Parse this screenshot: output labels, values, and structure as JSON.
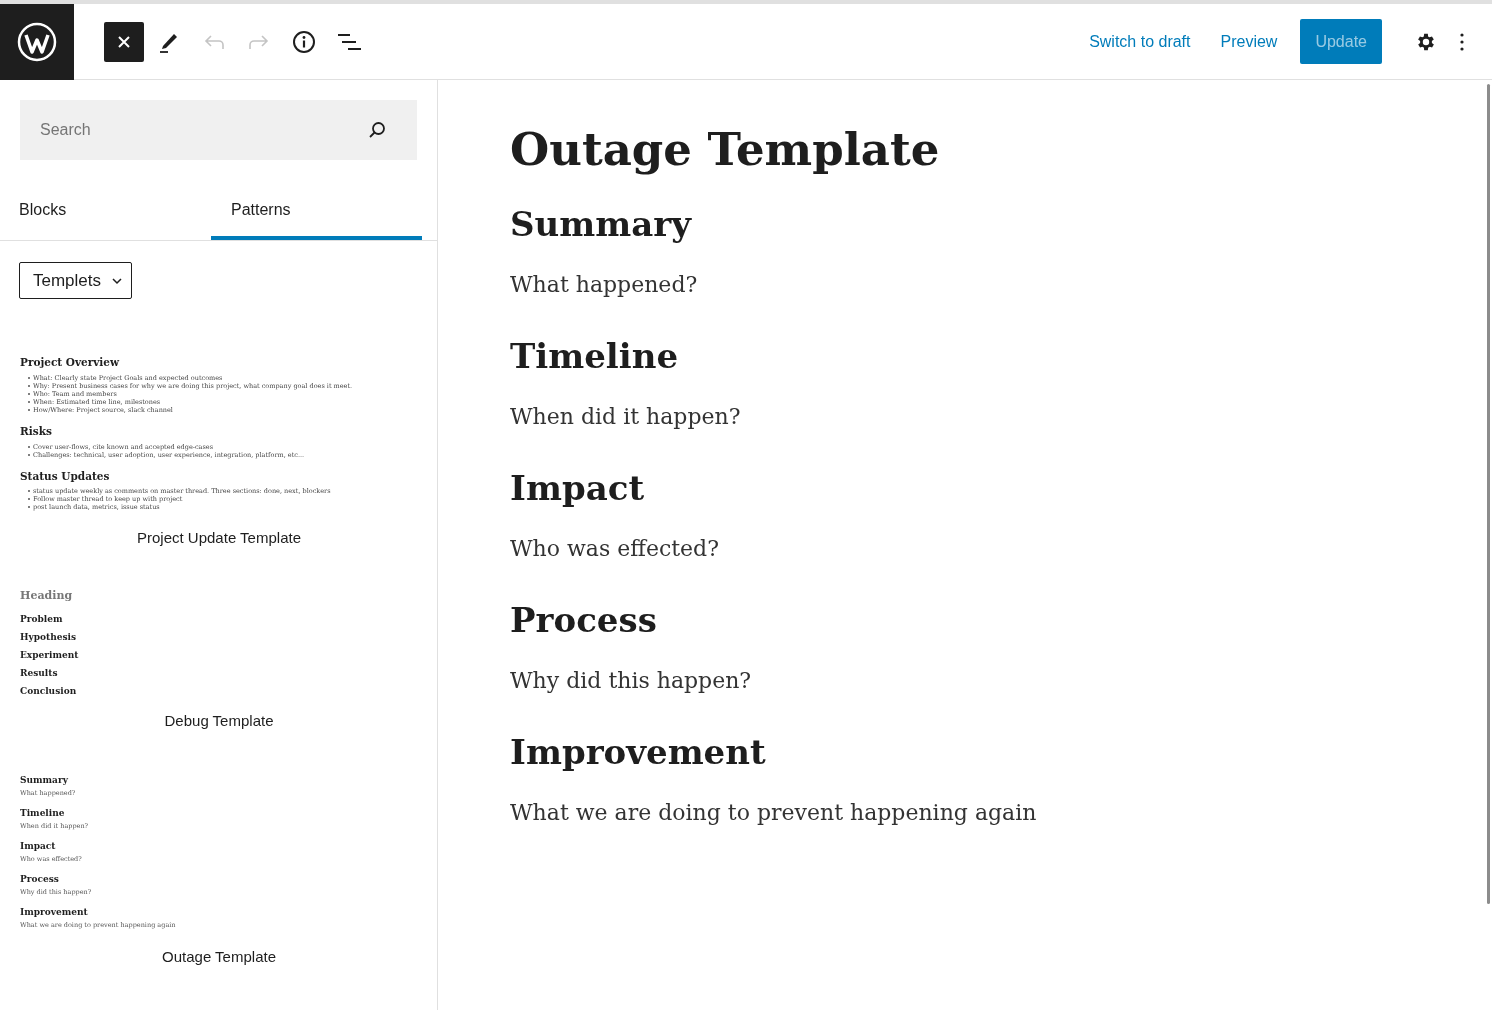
{
  "toolbar": {
    "tools": [
      {
        "kind": "close",
        "selected": true,
        "disabled": false
      },
      {
        "kind": "pencil",
        "selected": false,
        "disabled": false
      },
      {
        "kind": "undo",
        "selected": false,
        "disabled": true
      },
      {
        "kind": "redo",
        "selected": false,
        "disabled": true
      },
      {
        "kind": "info",
        "selected": false,
        "disabled": false
      },
      {
        "kind": "outline",
        "selected": false,
        "disabled": false
      }
    ],
    "actions": [
      {
        "kind": "link",
        "label": "Switch to draft"
      },
      {
        "kind": "link",
        "label": "Preview"
      },
      {
        "kind": "primary",
        "label": "Update",
        "disabled": true
      }
    ]
  },
  "inserter": {
    "search": {
      "placeholder": "Search"
    },
    "tabs": [
      {
        "label": "Blocks",
        "selected": false
      },
      {
        "label": "Patterns",
        "selected": true
      }
    ],
    "category": "Templets",
    "patterns": [
      {
        "label": "Project Update Template",
        "preview": [
          {
            "kind": "heading",
            "text": "Project Overview"
          },
          {
            "kind": "bullets",
            "items": [
              "What: Clearly state Project Goals and expected outcomes",
              "Why: Present business cases for why we are doing this project, what company goal does it meet.",
              "Who: Team and members",
              "When: Estimated time line, milestones",
              "How/Where: Project source, slack channel"
            ]
          },
          {
            "kind": "heading",
            "text": "Risks"
          },
          {
            "kind": "bullets",
            "items": [
              "Cover user-flows, cite known and accepted edge-cases",
              "Challenges: technical, user adoption, user experience, integration, platform, etc..."
            ]
          },
          {
            "kind": "heading",
            "text": "Status Updates"
          },
          {
            "kind": "bullets",
            "items": [
              "status update weekly as comments on master thread. Three sections: done, next, blockers",
              "Follow master thread to keep up with project",
              "post launch data, metrics, issue status"
            ]
          }
        ]
      },
      {
        "label": "Debug Template",
        "preview": [
          {
            "kind": "muted_heading",
            "text": "Heading"
          },
          {
            "kind": "subheading",
            "text": "Problem"
          },
          {
            "kind": "subheading",
            "text": "Hypothesis"
          },
          {
            "kind": "subheading",
            "text": "Experiment"
          },
          {
            "kind": "subheading",
            "text": "Results"
          },
          {
            "kind": "subheading",
            "text": "Conclusion"
          }
        ]
      },
      {
        "label": "Outage Template",
        "preview": [
          {
            "kind": "subheading",
            "text": "Summary"
          },
          {
            "kind": "paragraph",
            "text": "What happened?"
          },
          {
            "kind": "subheading",
            "text": "Timeline"
          },
          {
            "kind": "paragraph",
            "text": "When did it happen?"
          },
          {
            "kind": "subheading",
            "text": "Impact"
          },
          {
            "kind": "paragraph",
            "text": "Who was effected?"
          },
          {
            "kind": "subheading",
            "text": "Process"
          },
          {
            "kind": "paragraph",
            "text": "Why did this happen?"
          },
          {
            "kind": "subheading",
            "text": "Improvement"
          },
          {
            "kind": "paragraph",
            "text": "What we are doing to prevent happening again"
          }
        ]
      }
    ]
  },
  "editor": {
    "title": "Outage Template",
    "sections": [
      {
        "heading": "Summary",
        "text": "What happened?"
      },
      {
        "heading": "Timeline",
        "text": "When did it happen?"
      },
      {
        "heading": "Impact",
        "text": "Who was effected?"
      },
      {
        "heading": "Process",
        "text": "Why did this happen?"
      },
      {
        "heading": "Improvement",
        "text": "What we are doing to prevent happening again"
      }
    ]
  }
}
